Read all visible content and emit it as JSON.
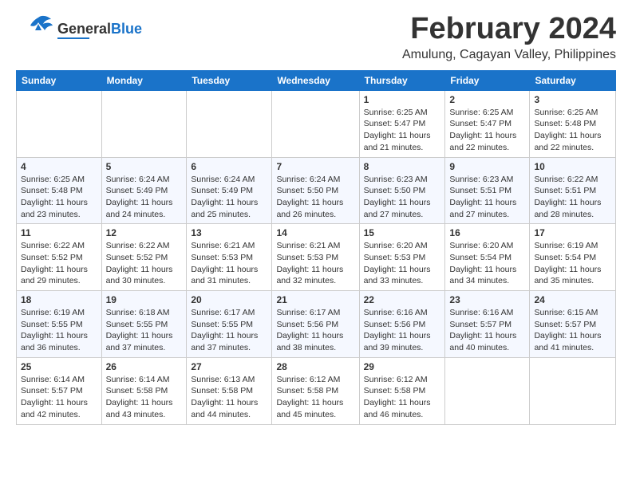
{
  "header": {
    "logo_general": "General",
    "logo_blue": "Blue",
    "title": "February 2024",
    "subtitle": "Amulung, Cagayan Valley, Philippines"
  },
  "days_of_week": [
    "Sunday",
    "Monday",
    "Tuesday",
    "Wednesday",
    "Thursday",
    "Friday",
    "Saturday"
  ],
  "weeks": [
    [
      {
        "day": "",
        "info": ""
      },
      {
        "day": "",
        "info": ""
      },
      {
        "day": "",
        "info": ""
      },
      {
        "day": "",
        "info": ""
      },
      {
        "day": "1",
        "info": "Sunrise: 6:25 AM\nSunset: 5:47 PM\nDaylight: 11 hours\nand 21 minutes."
      },
      {
        "day": "2",
        "info": "Sunrise: 6:25 AM\nSunset: 5:47 PM\nDaylight: 11 hours\nand 22 minutes."
      },
      {
        "day": "3",
        "info": "Sunrise: 6:25 AM\nSunset: 5:48 PM\nDaylight: 11 hours\nand 22 minutes."
      }
    ],
    [
      {
        "day": "4",
        "info": "Sunrise: 6:25 AM\nSunset: 5:48 PM\nDaylight: 11 hours\nand 23 minutes."
      },
      {
        "day": "5",
        "info": "Sunrise: 6:24 AM\nSunset: 5:49 PM\nDaylight: 11 hours\nand 24 minutes."
      },
      {
        "day": "6",
        "info": "Sunrise: 6:24 AM\nSunset: 5:49 PM\nDaylight: 11 hours\nand 25 minutes."
      },
      {
        "day": "7",
        "info": "Sunrise: 6:24 AM\nSunset: 5:50 PM\nDaylight: 11 hours\nand 26 minutes."
      },
      {
        "day": "8",
        "info": "Sunrise: 6:23 AM\nSunset: 5:50 PM\nDaylight: 11 hours\nand 27 minutes."
      },
      {
        "day": "9",
        "info": "Sunrise: 6:23 AM\nSunset: 5:51 PM\nDaylight: 11 hours\nand 27 minutes."
      },
      {
        "day": "10",
        "info": "Sunrise: 6:22 AM\nSunset: 5:51 PM\nDaylight: 11 hours\nand 28 minutes."
      }
    ],
    [
      {
        "day": "11",
        "info": "Sunrise: 6:22 AM\nSunset: 5:52 PM\nDaylight: 11 hours\nand 29 minutes."
      },
      {
        "day": "12",
        "info": "Sunrise: 6:22 AM\nSunset: 5:52 PM\nDaylight: 11 hours\nand 30 minutes."
      },
      {
        "day": "13",
        "info": "Sunrise: 6:21 AM\nSunset: 5:53 PM\nDaylight: 11 hours\nand 31 minutes."
      },
      {
        "day": "14",
        "info": "Sunrise: 6:21 AM\nSunset: 5:53 PM\nDaylight: 11 hours\nand 32 minutes."
      },
      {
        "day": "15",
        "info": "Sunrise: 6:20 AM\nSunset: 5:53 PM\nDaylight: 11 hours\nand 33 minutes."
      },
      {
        "day": "16",
        "info": "Sunrise: 6:20 AM\nSunset: 5:54 PM\nDaylight: 11 hours\nand 34 minutes."
      },
      {
        "day": "17",
        "info": "Sunrise: 6:19 AM\nSunset: 5:54 PM\nDaylight: 11 hours\nand 35 minutes."
      }
    ],
    [
      {
        "day": "18",
        "info": "Sunrise: 6:19 AM\nSunset: 5:55 PM\nDaylight: 11 hours\nand 36 minutes."
      },
      {
        "day": "19",
        "info": "Sunrise: 6:18 AM\nSunset: 5:55 PM\nDaylight: 11 hours\nand 37 minutes."
      },
      {
        "day": "20",
        "info": "Sunrise: 6:17 AM\nSunset: 5:55 PM\nDaylight: 11 hours\nand 37 minutes."
      },
      {
        "day": "21",
        "info": "Sunrise: 6:17 AM\nSunset: 5:56 PM\nDaylight: 11 hours\nand 38 minutes."
      },
      {
        "day": "22",
        "info": "Sunrise: 6:16 AM\nSunset: 5:56 PM\nDaylight: 11 hours\nand 39 minutes."
      },
      {
        "day": "23",
        "info": "Sunrise: 6:16 AM\nSunset: 5:57 PM\nDaylight: 11 hours\nand 40 minutes."
      },
      {
        "day": "24",
        "info": "Sunrise: 6:15 AM\nSunset: 5:57 PM\nDaylight: 11 hours\nand 41 minutes."
      }
    ],
    [
      {
        "day": "25",
        "info": "Sunrise: 6:14 AM\nSunset: 5:57 PM\nDaylight: 11 hours\nand 42 minutes."
      },
      {
        "day": "26",
        "info": "Sunrise: 6:14 AM\nSunset: 5:58 PM\nDaylight: 11 hours\nand 43 minutes."
      },
      {
        "day": "27",
        "info": "Sunrise: 6:13 AM\nSunset: 5:58 PM\nDaylight: 11 hours\nand 44 minutes."
      },
      {
        "day": "28",
        "info": "Sunrise: 6:12 AM\nSunset: 5:58 PM\nDaylight: 11 hours\nand 45 minutes."
      },
      {
        "day": "29",
        "info": "Sunrise: 6:12 AM\nSunset: 5:58 PM\nDaylight: 11 hours\nand 46 minutes."
      },
      {
        "day": "",
        "info": ""
      },
      {
        "day": "",
        "info": ""
      }
    ]
  ]
}
